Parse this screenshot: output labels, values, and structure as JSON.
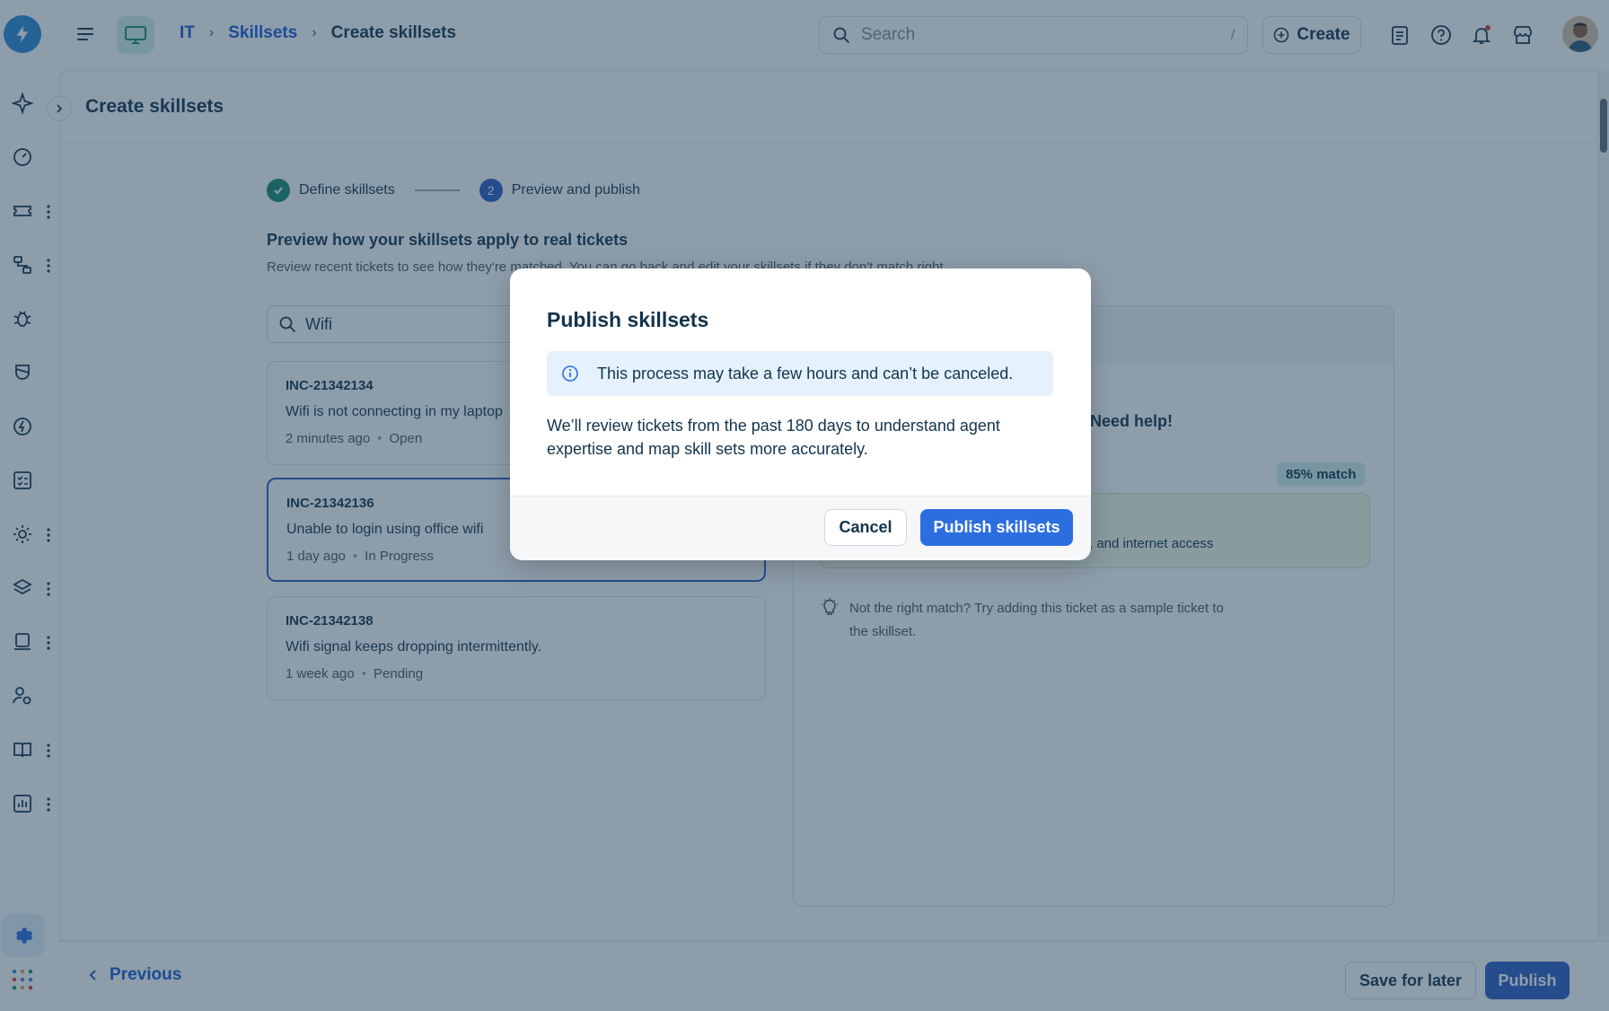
{
  "header": {
    "breadcrumb": [
      "IT",
      "Skillsets",
      "Create skillsets"
    ],
    "search_placeholder": "Search",
    "search_shortcut": "/",
    "create_label": "Create"
  },
  "page": {
    "title": "Create skillsets",
    "steps": [
      {
        "label": "Define skillsets",
        "status": "done"
      },
      {
        "label": "Preview and publish",
        "number": "2",
        "status": "current"
      }
    ],
    "section_title": "Preview how your skillsets apply to real tickets",
    "section_subtitle": "Review recent tickets to see how they're matched. You can go back and edit your skillsets if they don't match right.",
    "list_search_value": "Wifi",
    "tickets": [
      {
        "id": "INC-21342134",
        "desc": "Wifi is not connecting in my laptop",
        "time": "2 minutes ago",
        "status": "Open"
      },
      {
        "id": "INC-21342136",
        "desc": "Unable to login using office wifi",
        "time": "1 day ago",
        "status": "In Progress"
      },
      {
        "id": "INC-21342138",
        "desc": "Wifi signal keeps dropping intermittently.",
        "time": "1 week ago",
        "status": "Pending"
      }
    ],
    "preview": {
      "need_help": "Need help!",
      "match_badge": "85% match",
      "match_text": ", and internet access",
      "hint": "Not the right match? Try adding this ticket as a sample ticket to the skillset."
    }
  },
  "footer": {
    "previous_label": "Previous",
    "save_label": "Save for later",
    "publish_label": "Publish"
  },
  "modal": {
    "title": "Publish skillsets",
    "info": "This process may take a few hours and can’t be canceled.",
    "body": "We’ll review tickets from the past 180 days to understand agent expertise and map skill sets more accurately.",
    "cancel_label": "Cancel",
    "confirm_label": "Publish skillsets"
  },
  "colors": {
    "accent": "#2c6ee0",
    "brand": "#2c8bd9",
    "success": "#1a8a72",
    "text": "#12344d"
  }
}
